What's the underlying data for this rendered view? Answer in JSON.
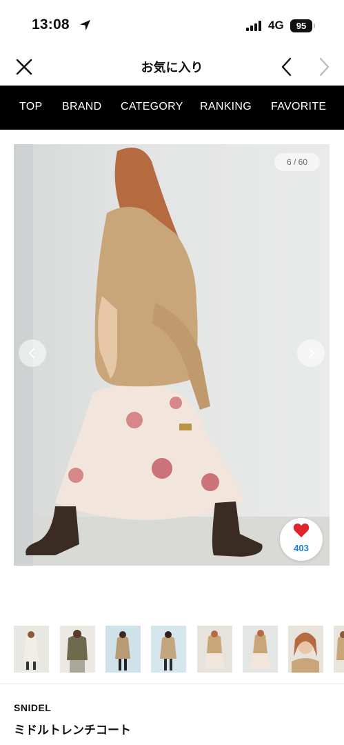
{
  "status_bar": {
    "time": "13:08",
    "network": "4G",
    "battery": "95"
  },
  "header": {
    "title": "お気に入り"
  },
  "nav": {
    "items": [
      "TOP",
      "BRAND",
      "CATEGORY",
      "RANKING",
      "FAVORITE"
    ]
  },
  "gallery": {
    "counter": "6 / 60",
    "favorite_count": "403"
  },
  "product": {
    "brand": "SNIDEL",
    "name": "ミドルトレンチコート"
  },
  "colors": {
    "nav_bg": "#000000",
    "heart": "#e0242b",
    "count_blue": "#1b7fd6"
  }
}
